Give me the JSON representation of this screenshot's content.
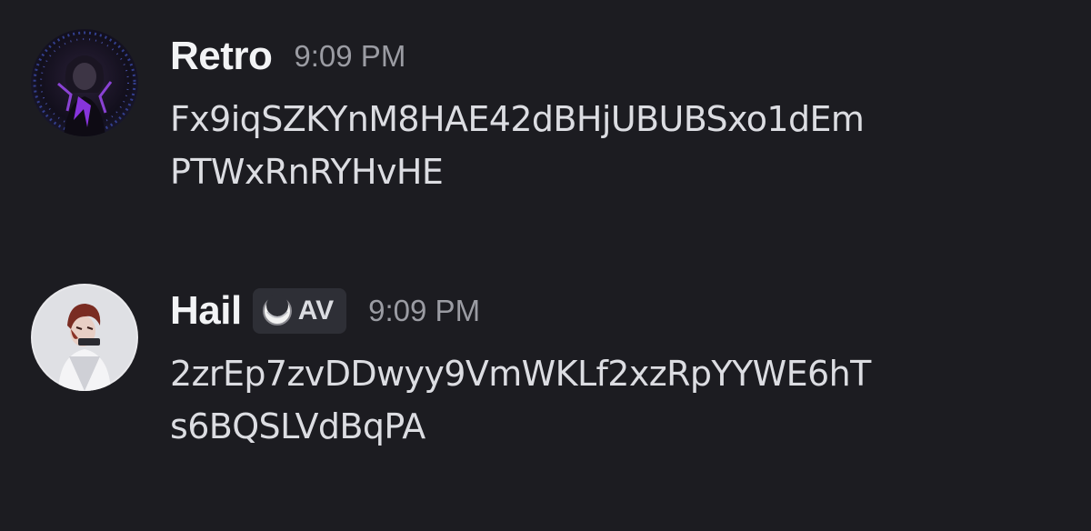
{
  "messages": [
    {
      "username": "Retro",
      "timestamp": "9:09 PM",
      "content_lines": [
        "Fx9iqSZKYnM8HAE42dBHjUBUBSxo1dEm",
        "PTWxRnRYHvHE"
      ],
      "avatar": "dark-anime-avatar-purple"
    },
    {
      "username": "Hail",
      "tag": {
        "icon": "crescent-moon-icon",
        "label": "AV"
      },
      "timestamp": "9:09 PM",
      "content_lines": [
        "2zrEp7zvDDwyy9VmWKLf2xzRpYYWE6hT",
        "s6BQSLVdBqPA"
      ],
      "avatar": "anime-avatar-red-hair"
    }
  ],
  "colors": {
    "background": "#1c1c21",
    "username": "#f2f3f5",
    "timestamp": "#9b9ca3",
    "text": "#dcdde2",
    "tag_background": "#2e2f36"
  }
}
